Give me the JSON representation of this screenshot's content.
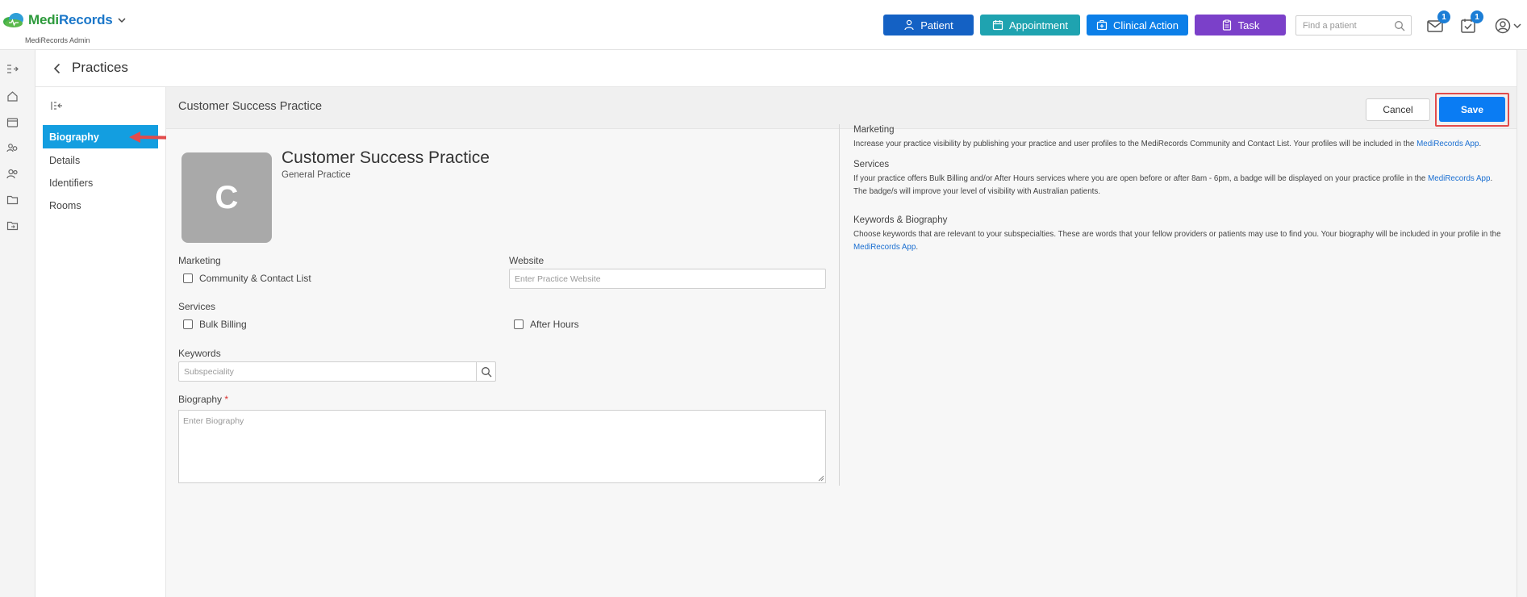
{
  "topbar": {
    "logo_medi": "Medi",
    "logo_records": "Records",
    "logo_sub": "MediRecords Admin",
    "buttons": [
      {
        "label": "Patient",
        "color": "#1461c4",
        "icon": "user-icon"
      },
      {
        "label": "Appointment",
        "color": "#1fa3b0",
        "icon": "calendar-icon"
      },
      {
        "label": "Clinical Action",
        "color": "#0c7fe8",
        "icon": "medical-kit-icon"
      },
      {
        "label": "Task",
        "color": "#7b40c9",
        "icon": "clipboard-icon"
      }
    ],
    "search_placeholder": "Find a patient",
    "mail_badge": "1",
    "tasks_badge": "1"
  },
  "breadcrumb": {
    "title": "Practices"
  },
  "subnav": {
    "items": [
      {
        "label": "Biography",
        "active": true
      },
      {
        "label": "Details",
        "active": false
      },
      {
        "label": "Identifiers",
        "active": false
      },
      {
        "label": "Rooms",
        "active": false
      }
    ]
  },
  "main": {
    "header_title": "Customer Success Practice",
    "cancel_label": "Cancel",
    "save_label": "Save",
    "avatar_letter": "C",
    "practice_name": "Customer Success Practice",
    "practice_type": "General Practice",
    "marketing_label": "Marketing",
    "community_label": "Community & Contact List",
    "website_label": "Website",
    "website_placeholder": "Enter Practice Website",
    "services_label": "Services",
    "bulk_billing_label": "Bulk Billing",
    "after_hours_label": "After Hours",
    "keywords_label": "Keywords",
    "keywords_placeholder": "Subspeciality",
    "biography_label": "Biography",
    "biography_required": "*",
    "biography_placeholder": "Enter Biography"
  },
  "info": {
    "marketing_title": "Marketing",
    "marketing_text": "Increase your practice visibility by publishing your practice and user profiles to the MediRecords Community and Contact List. Your profiles will be included in the",
    "marketing_link": "MediRecords App",
    "services_title": "Services",
    "services_text": "If your practice offers Bulk Billing and/or After Hours services where you are open before or after 8am - 6pm, a badge will be displayed on your practice profile in the",
    "services_link": "MediRecords App",
    "services_text2": "The badge/s will improve your level of visibility with Australian patients.",
    "keywords_title": "Keywords & Biography",
    "keywords_text": "Choose keywords that are relevant to your subspecialties. These are words that your fellow providers or patients may use to find you. Your biography will be included in your profile in the",
    "keywords_link": "MediRecords App"
  }
}
